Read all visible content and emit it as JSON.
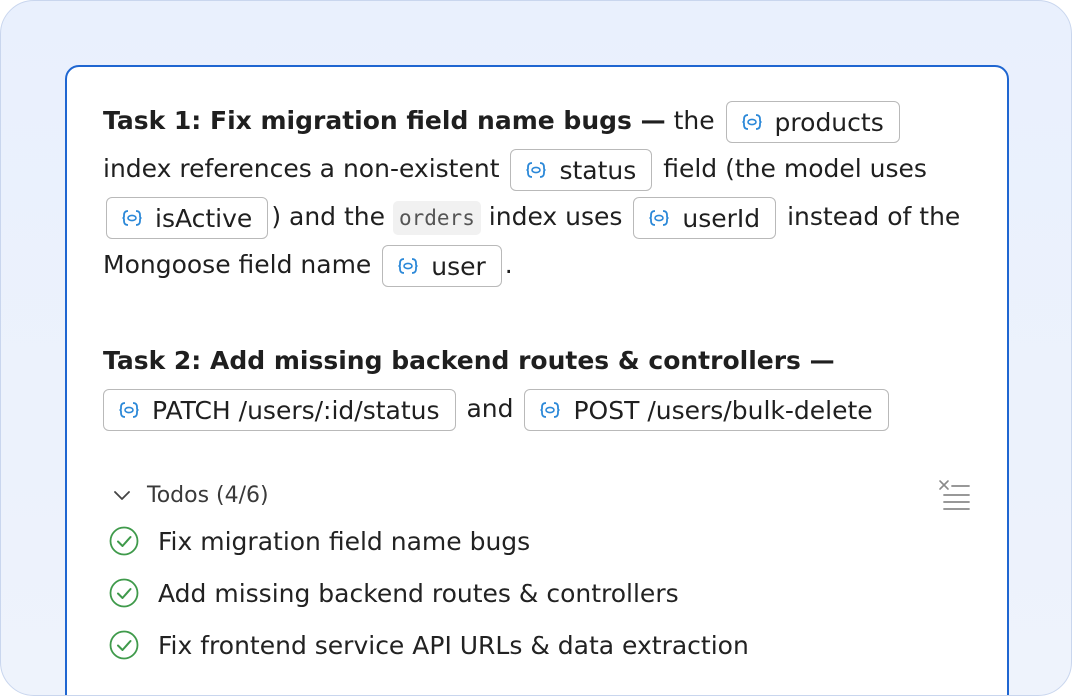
{
  "task1": {
    "title": "Task 1: Fix migration field name bugs —",
    "t1": "the",
    "chip_products": "products",
    "t2": "index references a non-existent",
    "chip_status": "status",
    "t3": "field (the model uses",
    "chip_isActive": "isActive",
    "t4": ") and the",
    "code_orders": "orders",
    "t5": "index uses",
    "chip_userId": "userId",
    "t6": "instead of the Mongoose field name",
    "chip_user": "user",
    "t7": "."
  },
  "task2": {
    "title": "Task 2: Add missing backend routes & controllers —",
    "chip_patch": "PATCH /users/:id/status",
    "t1": "and",
    "chip_post": "POST /users/bulk-delete"
  },
  "todos": {
    "header": "Todos (4/6)",
    "items": [
      {
        "label": "Fix migration field name bugs"
      },
      {
        "label": "Add missing backend routes & controllers"
      },
      {
        "label": "Fix frontend service API URLs & data extraction"
      }
    ]
  },
  "colors": {
    "accent": "#1f66d1",
    "icon_blue": "#2b88d8",
    "check_green": "#3f9a4b"
  }
}
